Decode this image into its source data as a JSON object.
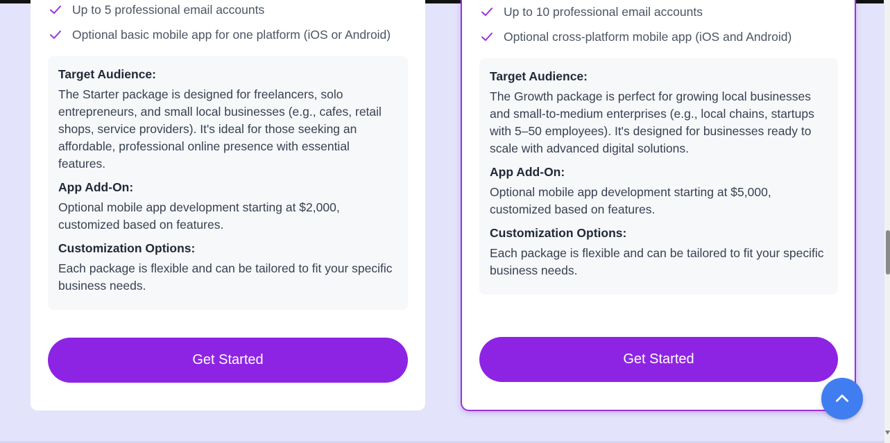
{
  "colors": {
    "accent": "#8e24e3",
    "check": "#9b30d9",
    "scrollTop": "#3f7df0"
  },
  "starter": {
    "features": [
      "Up to 5 professional email accounts",
      "Optional basic mobile app for one platform (iOS or Android)"
    ],
    "audience_label": "Target Audience:",
    "audience_text": "The Starter package is designed for freelancers, solo entrepreneurs, and small local businesses (e.g., cafes, retail shops, service providers). It's ideal for those seeking an affordable, professional online presence with essential features.",
    "addon_label": "App Add-On:",
    "addon_text": "Optional mobile app development starting at $2,000, customized based on features.",
    "custom_label": "Customization Options:",
    "custom_text": "Each package is flexible and can be tailored to fit your specific business needs.",
    "cta": "Get Started"
  },
  "growth": {
    "features": [
      "Up to 10 professional email accounts",
      "Optional cross-platform mobile app (iOS and Android)"
    ],
    "audience_label": "Target Audience:",
    "audience_text": "The Growth package is perfect for growing local businesses and small-to-medium enterprises (e.g., local chains, startups with 5–50 employees). It's designed for businesses ready to scale with advanced digital solutions.",
    "addon_label": "App Add-On:",
    "addon_text": "Optional mobile app development starting at $5,000, customized based on features.",
    "custom_label": "Customization Options:",
    "custom_text": "Each package is flexible and can be tailored to fit your specific business needs.",
    "cta": "Get Started"
  },
  "icons": {
    "check": "check-icon",
    "scroll_top": "chevron-up-icon"
  }
}
